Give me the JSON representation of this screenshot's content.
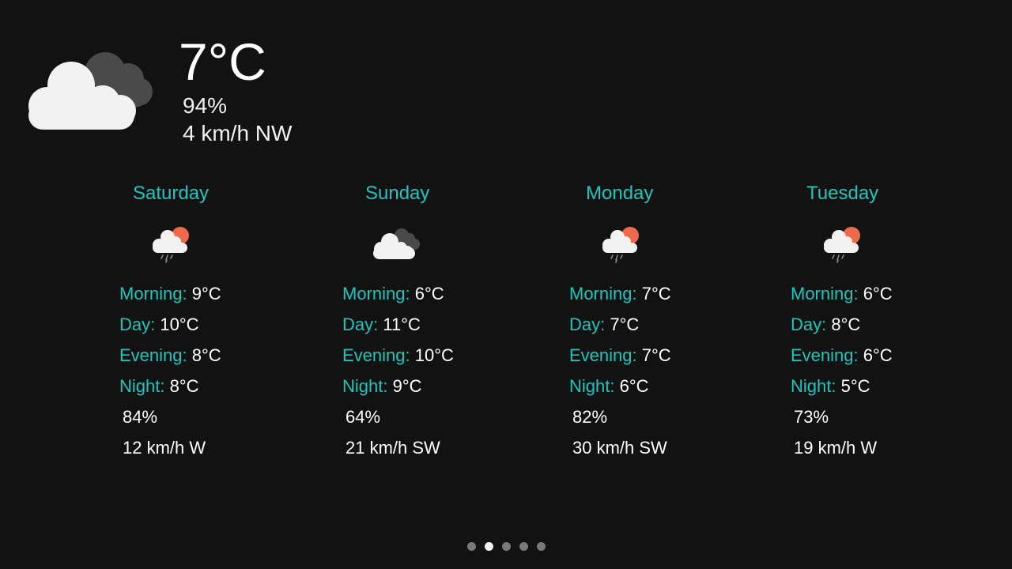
{
  "current": {
    "icon": "cloudy-icon",
    "temperature": "7°C",
    "humidity": "94%",
    "wind": "4 km/h NW"
  },
  "labels": {
    "morning": "Morning:",
    "day": "Day:",
    "evening": "Evening:",
    "night": "Night:"
  },
  "forecast": [
    {
      "day": "Saturday",
      "icon": "partly-sunny-rain-icon",
      "morning": "9°C",
      "day_temp": "10°C",
      "evening": "8°C",
      "night": "8°C",
      "humidity": "84%",
      "wind": "12 km/h W"
    },
    {
      "day": "Sunday",
      "icon": "cloudy-icon",
      "morning": "6°C",
      "day_temp": "11°C",
      "evening": "10°C",
      "night": "9°C",
      "humidity": "64%",
      "wind": "21 km/h SW"
    },
    {
      "day": "Monday",
      "icon": "partly-sunny-rain-icon",
      "morning": "7°C",
      "day_temp": "7°C",
      "evening": "7°C",
      "night": "6°C",
      "humidity": "82%",
      "wind": "30 km/h SW"
    },
    {
      "day": "Tuesday",
      "icon": "partly-sunny-rain-icon",
      "morning": "6°C",
      "day_temp": "8°C",
      "evening": "6°C",
      "night": "5°C",
      "humidity": "73%",
      "wind": "19 km/h W"
    }
  ],
  "pager": {
    "count": 5,
    "active_index": 1
  },
  "colors": {
    "accent": "#1fc6bd",
    "background": "#121212",
    "text": "#ffffff"
  }
}
